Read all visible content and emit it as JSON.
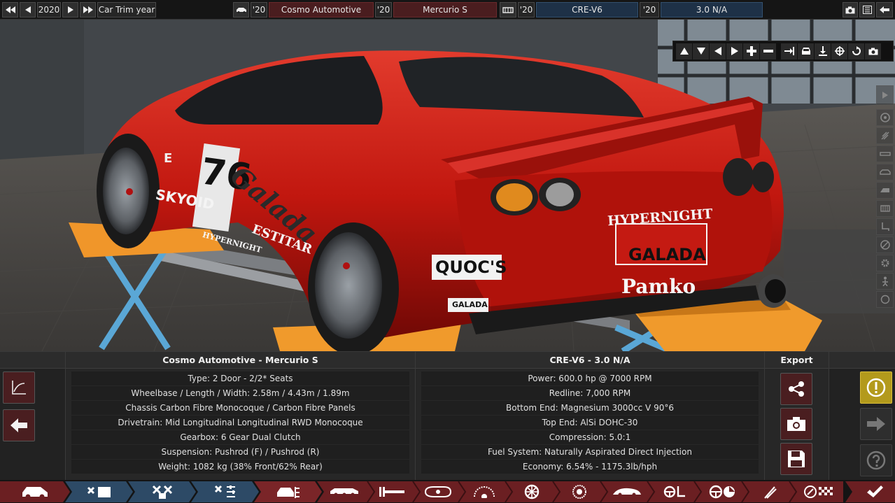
{
  "topbar": {
    "year": "2020",
    "trim_label": "Car Trim year",
    "model_year_short": "'20",
    "manufacturer": "Cosmo Automotive",
    "model_year_short_2": "'20",
    "model": "Mercurio S",
    "engine_year_short": "'20",
    "engine_family": "CRE-V6",
    "engine_year_short_2": "'20",
    "engine_variant": "3.0 N/A"
  },
  "decals": {
    "number": "76",
    "sponsor_main": "Galada",
    "sponsor_skyoid": "SKYOID",
    "sponsor_hyper": "HYPERNIGHT",
    "sponsor_estitar": "ESTITAR",
    "sponsor_quocs": "QUOC'S",
    "sponsor_galada_small": "GALADA",
    "plate": "GALADA",
    "brand": "Pamko",
    "side_letter": "E"
  },
  "info": {
    "car_header": "Cosmo Automotive - Mercurio S",
    "car_rows": [
      "Type: 2 Door - 2/2* Seats",
      "Wheelbase / Length / Width: 2.58m / 4.43m / 1.89m",
      "Chassis Carbon Fibre Monocoque / Carbon Fibre Panels",
      "Drivetrain: Mid Longitudinal Longitudinal RWD Monocoque",
      "Gearbox: 6 Gear Dual Clutch",
      "Suspension: Pushrod (F) / Pushrod (R)",
      "Weight: 1082 kg (38% Front/62% Rear)"
    ],
    "engine_header": "CRE-V6 - 3.0 N/A",
    "engine_rows": [
      "Power: 600.0 hp @ 7000 RPM",
      "Redline:  7,000 RPM",
      "Bottom End: Magnesium 3000cc V 90°6",
      "Top End: AlSi DOHC-30",
      "Compression: 5.0:1",
      "Fuel System: Naturally Aspirated Direct Injection",
      "Economy: 6.54% - 1175.3lb/hph"
    ],
    "export_header": "Export"
  },
  "colors": {
    "accent_red": "#6b1f22",
    "accent_blue": "#1e3147",
    "warning_yellow": "#b39a1c"
  },
  "icons": {
    "camera": "camera-icon",
    "screenshot": "screenshot-icon",
    "share": "share-icon",
    "save": "save-icon",
    "warning": "warning-icon",
    "help": "help-icon"
  }
}
